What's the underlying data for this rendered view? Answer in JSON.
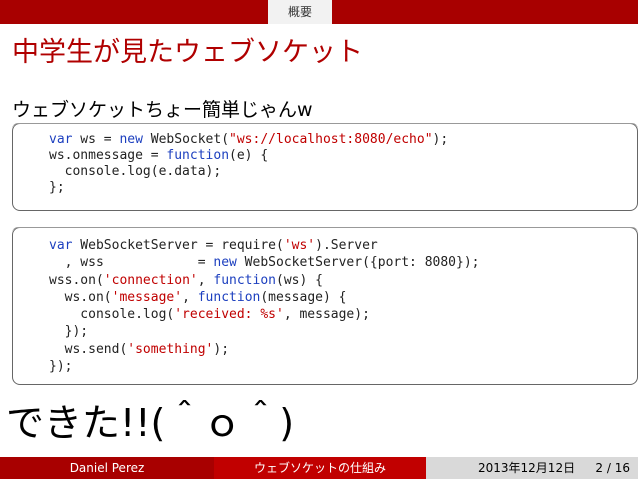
{
  "header": {
    "section_tab": "概要"
  },
  "slide": {
    "title": "中学生が見たウェブソケット",
    "subtitle": "ウェブソケットちょー簡単じゃんw",
    "code_client": [
      [
        "var",
        " ws = ",
        "new",
        " WebSocket(",
        "\"ws://localhost:8080/echo\"",
        ");"
      ],
      [
        "ws.onmessage = ",
        "function",
        "(e) {"
      ],
      [
        "  console.log(e.data);"
      ],
      [
        "};"
      ]
    ],
    "code_server": {
      "line1": {
        "kw": "var",
        "a": " WebSocketServer = require(",
        "s": "'ws'",
        "b": ").Server"
      },
      "line2": {
        "a": "  , wss            = ",
        "kw": "new",
        "b": " WebSocketServer({port: 8080});"
      },
      "line3": {
        "a": "wss.on(",
        "s": "'connection'",
        "b": ", ",
        "kw": "function",
        "c": "(ws) {"
      },
      "line4": {
        "a": "  ws.on(",
        "s": "'message'",
        "b": ", ",
        "kw": "function",
        "c": "(message) {"
      },
      "line5": {
        "a": "    console.log(",
        "s": "'received: %s'",
        "b": ", message);"
      },
      "line6": {
        "a": "  });"
      },
      "line7": {
        "a": "  ws.send(",
        "s": "'something'",
        "b": ");"
      },
      "line8": {
        "a": "});"
      }
    },
    "closing": "できた!!(＾ｏ＾)"
  },
  "footer": {
    "author": "Daniel Perez",
    "talk_title": "ウェブソケットの仕組み",
    "date": "2013年12月12日",
    "page": "2 / 16"
  },
  "colors": {
    "bar": "#a80000",
    "title": "#b00000",
    "keyword": "#1c3fbf",
    "string": "#c00000"
  }
}
